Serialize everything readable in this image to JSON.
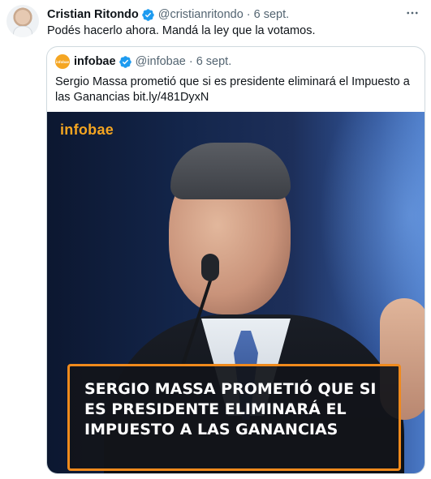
{
  "tweet": {
    "author_name": "Cristian Ritondo",
    "handle": "@cristianritondo",
    "separator": "·",
    "date": "6 sept.",
    "more_icon": "more-horizontal-icon",
    "text": "Podés hacerlo ahora. Mandá la ley que la votamos."
  },
  "quote": {
    "avatar_text": "infobae",
    "author_name": "infobae",
    "handle": "@infobae",
    "separator": "·",
    "date": "6 sept.",
    "text": "Sergio Massa prometió que si es presidente eliminará el Impuesto a las Ganancias bit.ly/481DyxN",
    "media": {
      "brand": "infobae",
      "caption": "SERGIO MASSA PROMETIÓ QUE SI ES PRESIDENTE ELIMINARÁ EL IMPUESTO A LAS GANANCIAS"
    }
  },
  "colors": {
    "verified": "#1d9bf0",
    "infobae_orange": "#f4a521",
    "caption_border": "#f08a1c",
    "muted_text": "#536471"
  }
}
